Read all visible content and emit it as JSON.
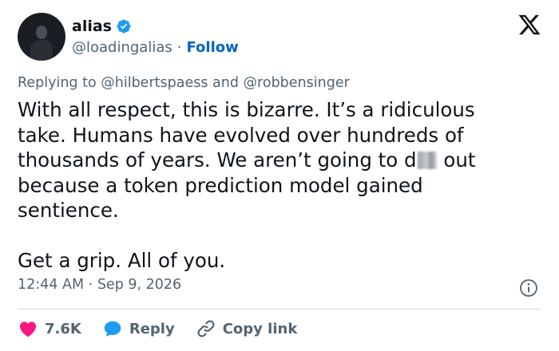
{
  "author": {
    "display_name": "alias",
    "handle": "@loadingalias",
    "separator": "·",
    "follow_label": "Follow",
    "verified_icon": "verified-badge-icon",
    "brand_icon": "x-logo-icon"
  },
  "reply": {
    "prefix": "Replying to",
    "mention_1": "@hilbertspaess",
    "conjunction": "and",
    "mention_2": "@robbensinger"
  },
  "tweet": {
    "line_1": "With all respect, this is bizarre. It’s a ridiculous",
    "line_2": "take. Humans have evolved over hundreds of",
    "line_3_before": "thousands of years. We aren’t going to d",
    "line_3_after": " out",
    "line_4": "because a token prediction model gained",
    "line_5": "sentience.",
    "line_6": "Get a grip. All of you."
  },
  "meta": {
    "time": "12:44 AM",
    "separator": "·",
    "date": "Sep 9, 2026",
    "info_icon": "info-icon"
  },
  "actions": {
    "likes": "7.6K",
    "reply_label": "Reply",
    "copy_label": "Copy link"
  },
  "colors": {
    "text": "#0f1419",
    "secondary": "#536471",
    "accent": "#0064c8",
    "verified": "#1d9bf0",
    "like": "#f91880",
    "reply": "#1d9bf0",
    "divider": "#cfd9de"
  }
}
